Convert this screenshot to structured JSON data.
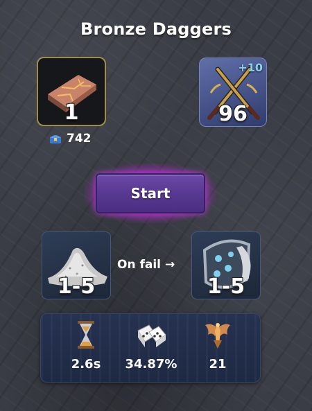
{
  "title": "Bronze Daggers",
  "input_item": {
    "icon": "bronze-ingot-icon",
    "quantity": "1"
  },
  "bank": {
    "icon": "bank-chest-icon",
    "count": "742"
  },
  "output_item": {
    "icon": "crossed-daggers-icon",
    "bonus": "+10",
    "quantity": "96"
  },
  "start_button": {
    "label": "Start"
  },
  "materials": {
    "input": {
      "icon": "powder-pile-icon",
      "range": "1-5"
    },
    "fail_label": "On fail",
    "fail_arrow": "→",
    "output": {
      "icon": "shield-gems-icon",
      "range": "1-5"
    }
  },
  "stats": [
    {
      "icon": "hourglass-icon",
      "value": "2.6s"
    },
    {
      "icon": "dice-icon",
      "value": "34.87%"
    },
    {
      "icon": "winged-emblem-icon",
      "value": "21"
    }
  ],
  "colors": {
    "ingot_border": "#a08c4a",
    "start_glow": "#b228d2",
    "start_button": "#5a3a94",
    "bonus_text": "#8fd0e8"
  }
}
